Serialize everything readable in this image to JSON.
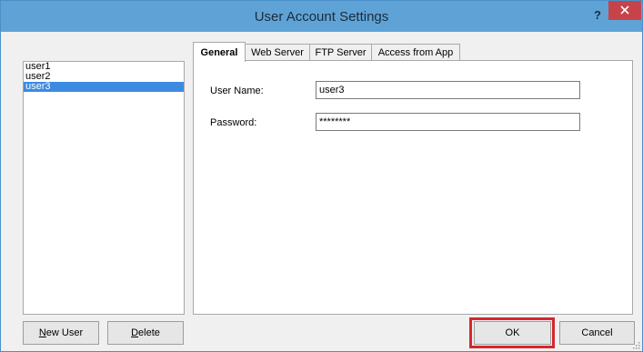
{
  "window": {
    "title": "User Account Settings",
    "help_label": "?"
  },
  "users": {
    "items": [
      "user1",
      "user2",
      "user3"
    ],
    "selected": "user3"
  },
  "buttons": {
    "new_user_prefix": "N",
    "new_user_rest": "ew User",
    "delete_prefix": "D",
    "delete_rest": "elete",
    "ok": "OK",
    "cancel": "Cancel"
  },
  "tabs": [
    {
      "label": "General",
      "active": true
    },
    {
      "label": "Web Server",
      "active": false
    },
    {
      "label": "FTP Server",
      "active": false
    },
    {
      "label": "Access from App",
      "active": false
    }
  ],
  "general": {
    "username_label": "User Name:",
    "username_value": "user3",
    "password_label": "Password:",
    "password_value": "********"
  },
  "colors": {
    "titlebar": "#5fa3d6",
    "close_button": "#c7434a",
    "selection": "#3d8be0",
    "ok_highlight": "#d4282e"
  }
}
